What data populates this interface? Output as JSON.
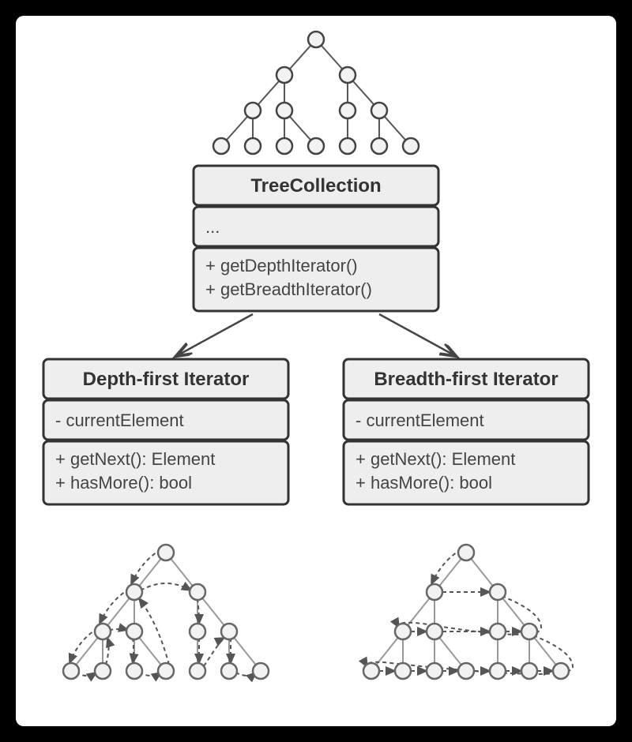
{
  "treeCollection": {
    "title": "TreeCollection",
    "attrs": "...",
    "methods": [
      "+ getDepthIterator()",
      "+ getBreadthIterator()"
    ]
  },
  "depthIterator": {
    "title": "Depth-first Iterator",
    "attrs": [
      "- currentElement"
    ],
    "methods": [
      "+ getNext(): Element",
      "+ hasMore(): bool"
    ]
  },
  "breadthIterator": {
    "title": "Breadth-first Iterator",
    "attrs": [
      "- currentElement"
    ],
    "methods": [
      "+ getNext(): Element",
      "+ hasMore(): bool"
    ]
  }
}
